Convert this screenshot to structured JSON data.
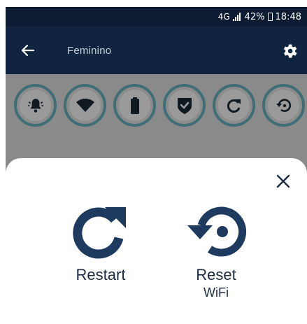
{
  "status_bar": {
    "network": "4G",
    "battery_percent": "42%",
    "time": "18:48"
  },
  "app_bar": {
    "title": "Feminino",
    "back_icon": "arrow-left-icon",
    "settings_icon": "gear-icon"
  },
  "quick_actions": [
    {
      "name": "alarm",
      "icon": "alarm-bell-icon"
    },
    {
      "name": "wifi",
      "icon": "wifi-icon"
    },
    {
      "name": "battery",
      "icon": "battery-icon"
    },
    {
      "name": "shield",
      "icon": "shield-check-icon"
    },
    {
      "name": "restart",
      "icon": "restart-icon"
    },
    {
      "name": "reset",
      "icon": "reset-icon"
    }
  ],
  "sheet": {
    "close_icon": "close-icon",
    "restart": {
      "label": "Restart",
      "icon": "restart-icon"
    },
    "reset": {
      "label": "Reset",
      "sub_label": "WiFi",
      "icon": "reset-icon"
    }
  },
  "colors": {
    "header_bg": "#10233f",
    "status_bg": "#0d1c33",
    "accent": "#1e3a5f",
    "ring": "#3f6e76",
    "overlay": "#8a8a8a"
  }
}
